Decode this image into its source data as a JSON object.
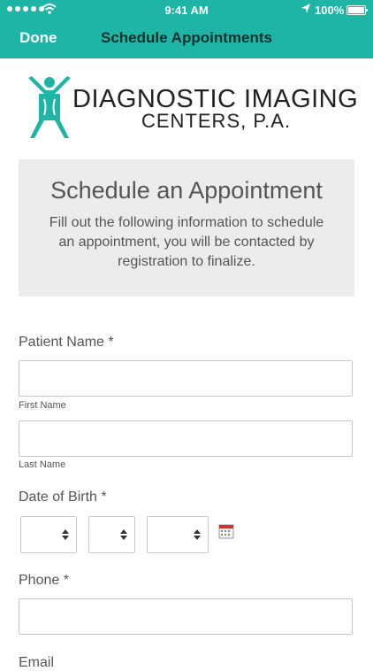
{
  "status_bar": {
    "time": "9:41 AM",
    "battery": "100%"
  },
  "nav": {
    "done": "Done",
    "title": "Schedule Appointments"
  },
  "logo": {
    "line1": "DIAGNOSTIC IMAGING",
    "line2": "CENTERS, P.A."
  },
  "header": {
    "title": "Schedule an Appointment",
    "description": "Fill out the following information to schedule an appointment, you will be contacted by registration to finalize."
  },
  "form": {
    "patient_name_label": "Patient Name",
    "required_mark": "*",
    "first_name_label": "First Name",
    "last_name_label": "Last Name",
    "dob_label": "Date of Birth",
    "phone_label": "Phone",
    "email_label": "Email"
  },
  "colors": {
    "accent": "#1fb5a6",
    "card_bg": "#ececed"
  }
}
